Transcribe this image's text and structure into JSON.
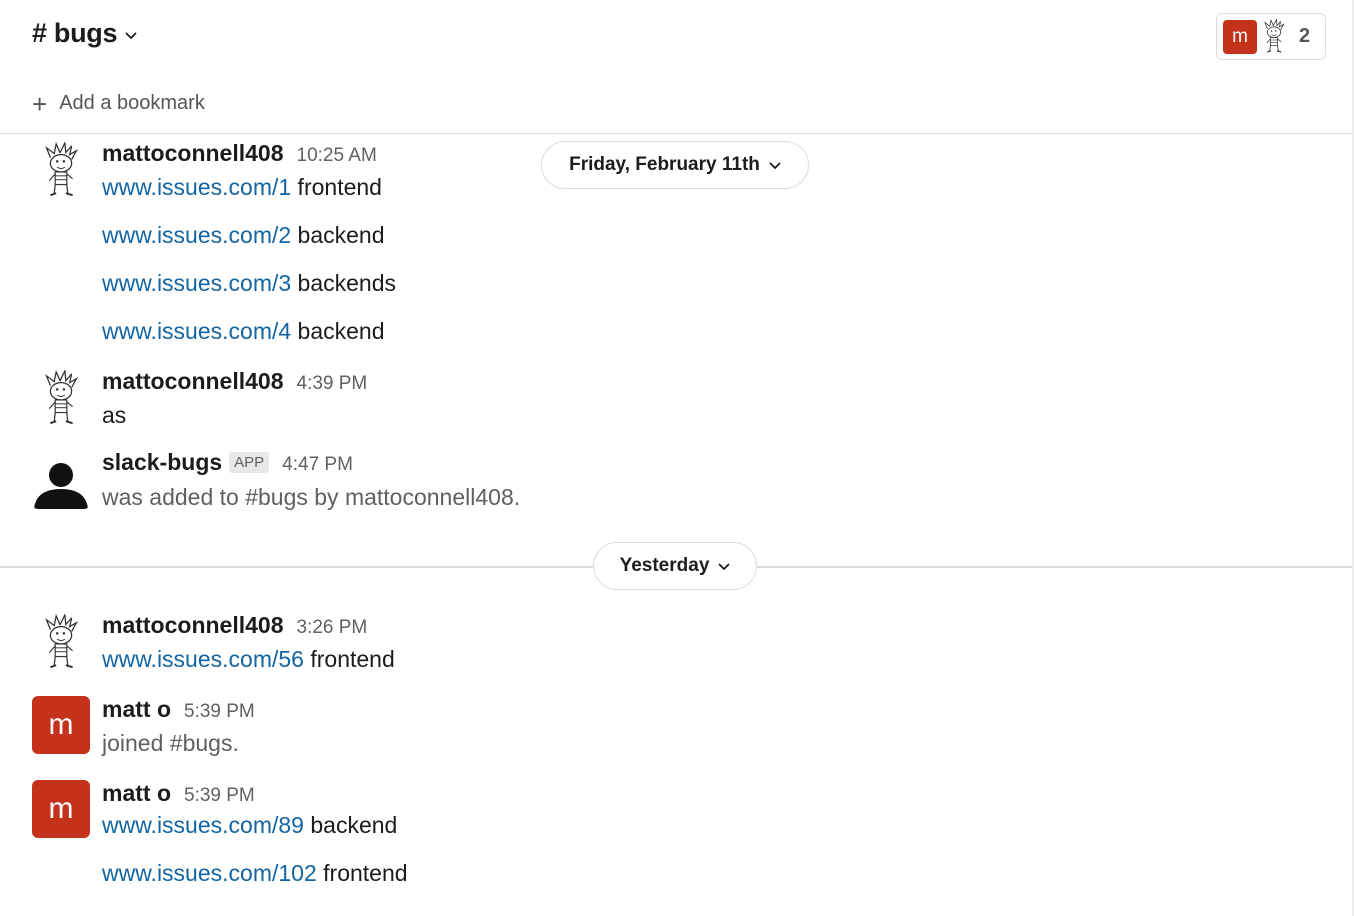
{
  "channel": {
    "title": "# bugs"
  },
  "members": {
    "avatar_letter": "m",
    "count": "2"
  },
  "bookmark": {
    "label": "Add a bookmark"
  },
  "dates": {
    "first": "Friday, February 11th",
    "second": "Yesterday"
  },
  "messages": [
    {
      "sender": "mattoconnell408",
      "time": "10:25 AM",
      "lines": [
        {
          "link": "www.issues.com/1",
          "text": " frontend"
        },
        {
          "link": "www.issues.com/2",
          "text": " backend"
        },
        {
          "link": "www.issues.com/3",
          "text": " backends"
        },
        {
          "link": "www.issues.com/4",
          "text": " backend"
        }
      ]
    },
    {
      "sender": "mattoconnell408",
      "time": "4:39 PM",
      "lines": [
        {
          "text": "as"
        }
      ]
    },
    {
      "sender": "slack-bugs",
      "badge": "APP",
      "time": "4:47 PM",
      "lines": [
        {
          "text": "was added to #bugs by mattoconnell408."
        }
      ]
    },
    {
      "sender": "mattoconnell408",
      "time": "3:26 PM",
      "lines": [
        {
          "link": "www.issues.com/56",
          "text": " frontend"
        }
      ]
    },
    {
      "sender": "matt o",
      "avatar_letter": "m",
      "time": "5:39 PM",
      "lines": [
        {
          "text": "joined #bugs."
        }
      ]
    },
    {
      "sender": "matt o",
      "avatar_letter": "m",
      "time": "5:39 PM",
      "lines": [
        {
          "link": "www.issues.com/89",
          "text": " backend"
        },
        {
          "link": "www.issues.com/102",
          "text": " frontend"
        }
      ]
    }
  ],
  "colors": {
    "link": "#1264a3",
    "avatar_red": "#c5321c",
    "muted": "#616061"
  },
  "icons": {
    "header_chevron": "chevron-down-icon",
    "bookmark_plus": "plus-icon",
    "bot_avatar": "person-silhouette-icon",
    "cartoon_avatar": "cartoon-boy-avatar"
  }
}
